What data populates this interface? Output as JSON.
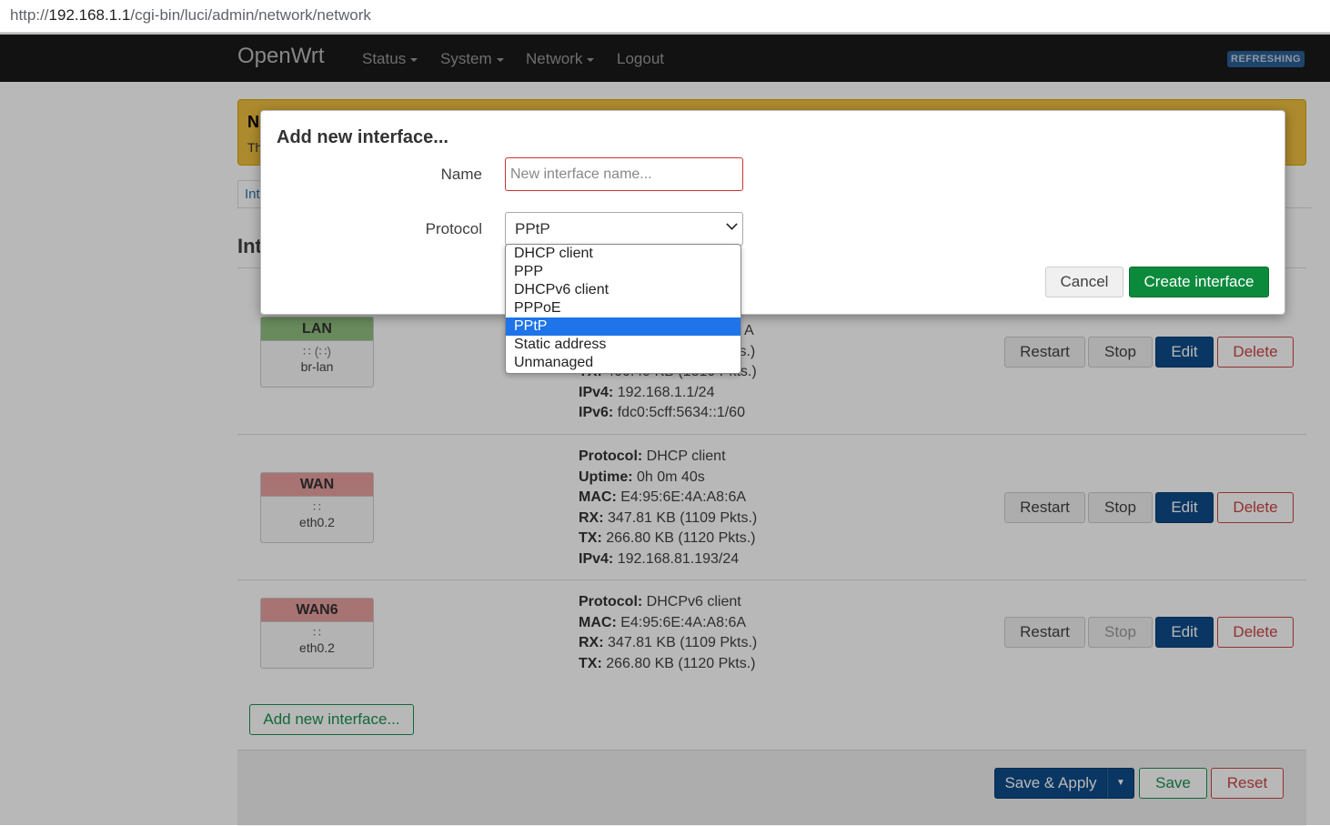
{
  "browser": {
    "url_prefix": "http://",
    "url_host": "192.168.1.1",
    "url_path": "/cgi-bin/luci/admin/network/network"
  },
  "topbar": {
    "brand": "OpenWrt",
    "menu": [
      {
        "label": "Status"
      },
      {
        "label": "System"
      },
      {
        "label": "Network"
      },
      {
        "label": "Logout"
      }
    ],
    "badge": "REFRESHING"
  },
  "notice": {
    "title": "N",
    "text": "Th"
  },
  "tabs": {
    "active": "Int"
  },
  "section_title": "Int",
  "interfaces": [
    {
      "name": "LAN",
      "device": "br-lan",
      "icon": "bridge-icon",
      "info": [
        {
          "k": "",
          "v": "A"
        },
        {
          "k": "",
          "v": "ts.)"
        },
        {
          "k": "TX:",
          "v": "400.49 KB (1310 Pkts.)"
        },
        {
          "k": "IPv4:",
          "v": "192.168.1.1/24"
        },
        {
          "k": "IPv6:",
          "v": "fdc0:5cff:5634::1/60"
        }
      ]
    },
    {
      "name": "WAN",
      "device": "eth0.2",
      "icon": "ethernet-icon",
      "info": [
        {
          "k": "Protocol:",
          "v": "DHCP client"
        },
        {
          "k": "Uptime:",
          "v": "0h 0m 40s"
        },
        {
          "k": "MAC:",
          "v": "E4:95:6E:4A:A8:6A"
        },
        {
          "k": "RX:",
          "v": "347.81 KB (1109 Pkts.)"
        },
        {
          "k": "TX:",
          "v": "266.80 KB (1120 Pkts.)"
        },
        {
          "k": "IPv4:",
          "v": "192.168.81.193/24"
        }
      ]
    },
    {
      "name": "WAN6",
      "device": "eth0.2",
      "icon": "ethernet-icon",
      "info": [
        {
          "k": "Protocol:",
          "v": "DHCPv6 client"
        },
        {
          "k": "MAC:",
          "v": "E4:95:6E:4A:A8:6A"
        },
        {
          "k": "RX:",
          "v": "347.81 KB (1109 Pkts.)"
        },
        {
          "k": "TX:",
          "v": "266.80 KB (1120 Pkts.)"
        }
      ]
    }
  ],
  "row_buttons": {
    "restart": "Restart",
    "stop": "Stop",
    "edit": "Edit",
    "delete": "Delete"
  },
  "add_button": "Add new interface...",
  "footer": {
    "save_apply": "Save & Apply",
    "save": "Save",
    "reset": "Reset"
  },
  "modal": {
    "title": "Add new interface...",
    "name_label": "Name",
    "name_placeholder": "New interface name...",
    "protocol_label": "Protocol",
    "protocol_value": "PPtP",
    "options": [
      "DHCP client",
      "PPP",
      "DHCPv6 client",
      "PPPoE",
      "PPtP",
      "Static address",
      "Unmanaged"
    ],
    "selected_option": "PPtP",
    "cancel": "Cancel",
    "create": "Create interface"
  },
  "colors": {
    "create_green": "#0b8a3c",
    "edit_blue": "#0e4c8a",
    "selected_option": "#1e74e8",
    "lan_header": "#90c080",
    "wan_header": "#e8a0a0"
  }
}
